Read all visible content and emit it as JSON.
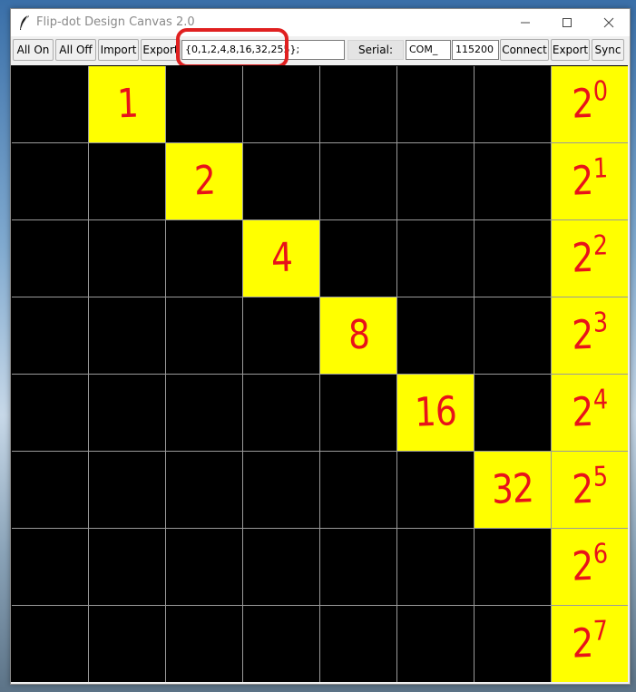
{
  "window": {
    "title": "Flip-dot Design Canvas 2.0"
  },
  "toolbar": {
    "all_on": "All On",
    "all_off": "All Off",
    "import": "Import",
    "export": "Export",
    "pattern_value": "{0,1,2,4,8,16,32,255};",
    "serial_label": "Serial:",
    "port_value": "COM_",
    "baud_value": "115200",
    "connect": "Connect",
    "export2": "Export",
    "sync": "Sync"
  },
  "grid": {
    "rows": 8,
    "cols": 8,
    "on_color": "#ffff00",
    "off_color": "#000000",
    "annotation_color": "#e8121a",
    "on_cells": [
      [
        0,
        1
      ],
      [
        0,
        7
      ],
      [
        1,
        2
      ],
      [
        1,
        7
      ],
      [
        2,
        3
      ],
      [
        2,
        7
      ],
      [
        3,
        4
      ],
      [
        3,
        7
      ],
      [
        4,
        5
      ],
      [
        4,
        7
      ],
      [
        5,
        6
      ],
      [
        5,
        7
      ],
      [
        6,
        7
      ],
      [
        7,
        7
      ]
    ],
    "annotations": [
      {
        "row": 0,
        "col": 1,
        "text": "1"
      },
      {
        "row": 1,
        "col": 2,
        "text": "2"
      },
      {
        "row": 2,
        "col": 3,
        "text": "4"
      },
      {
        "row": 3,
        "col": 4,
        "text": "8"
      },
      {
        "row": 4,
        "col": 5,
        "text": "16"
      },
      {
        "row": 5,
        "col": 6,
        "text": "32"
      },
      {
        "row": 0,
        "col": 7,
        "text": "2",
        "exp": "0"
      },
      {
        "row": 1,
        "col": 7,
        "text": "2",
        "exp": "1"
      },
      {
        "row": 2,
        "col": 7,
        "text": "2",
        "exp": "2"
      },
      {
        "row": 3,
        "col": 7,
        "text": "2",
        "exp": "3"
      },
      {
        "row": 4,
        "col": 7,
        "text": "2",
        "exp": "4"
      },
      {
        "row": 5,
        "col": 7,
        "text": "2",
        "exp": "5"
      },
      {
        "row": 6,
        "col": 7,
        "text": "2",
        "exp": "6"
      },
      {
        "row": 7,
        "col": 7,
        "text": "2",
        "exp": "7"
      }
    ]
  }
}
